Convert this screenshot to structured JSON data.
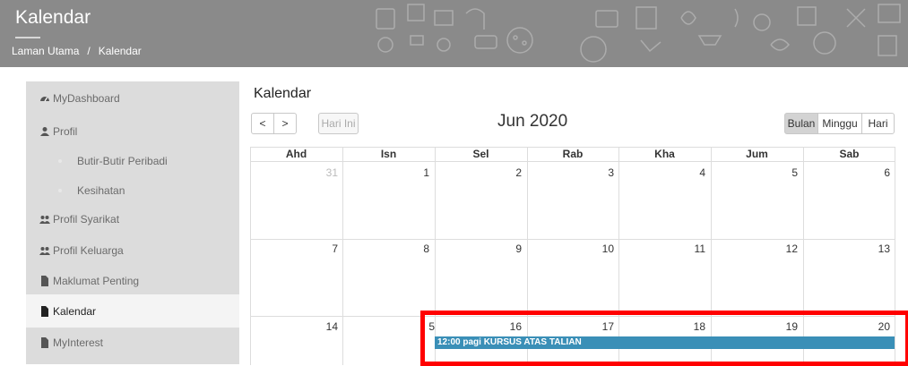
{
  "header": {
    "title": "Kalendar",
    "breadcrumb": {
      "home": "Laman Utama",
      "separator": "/",
      "current": "Kalendar"
    },
    "banner_color": "#8a8a8a"
  },
  "sidebar": {
    "items": [
      {
        "label": "MyDashboard",
        "icon": "dashboard-icon"
      },
      {
        "label": "Profil",
        "icon": "user-icon"
      },
      {
        "label": "Butir-Butir Peribadi",
        "icon": ""
      },
      {
        "label": "Kesihatan",
        "icon": ""
      },
      {
        "label": "Profil Syarikat",
        "icon": "users-icon"
      },
      {
        "label": "Profil Keluarga",
        "icon": "users-icon"
      },
      {
        "label": "Maklumat Penting",
        "icon": "file-icon"
      },
      {
        "label": "Kalendar",
        "icon": "file-icon"
      },
      {
        "label": "MyInterest",
        "icon": "file-icon"
      }
    ]
  },
  "calendar": {
    "title": "Kalendar",
    "prev_label": "<",
    "next_label": ">",
    "today_label": "Hari Ini",
    "month_label": "Jun 2020",
    "views": {
      "month": "Bulan",
      "week": "Minggu",
      "day": "Hari"
    },
    "days_of_week": [
      "Ahd",
      "Isn",
      "Sel",
      "Rab",
      "Kha",
      "Jum",
      "Sab"
    ],
    "weeks": [
      [
        "31",
        "1",
        "2",
        "3",
        "4",
        "5",
        "6"
      ],
      [
        "7",
        "8",
        "9",
        "10",
        "11",
        "12",
        "13"
      ],
      [
        "14",
        "5",
        "16",
        "17",
        "18",
        "19",
        "20"
      ]
    ],
    "event": {
      "time": "12:00 pagi",
      "title": "KURSUS ATAS TALIAN",
      "color": "#3a8fb7"
    },
    "highlight_color": "#ff0000"
  }
}
